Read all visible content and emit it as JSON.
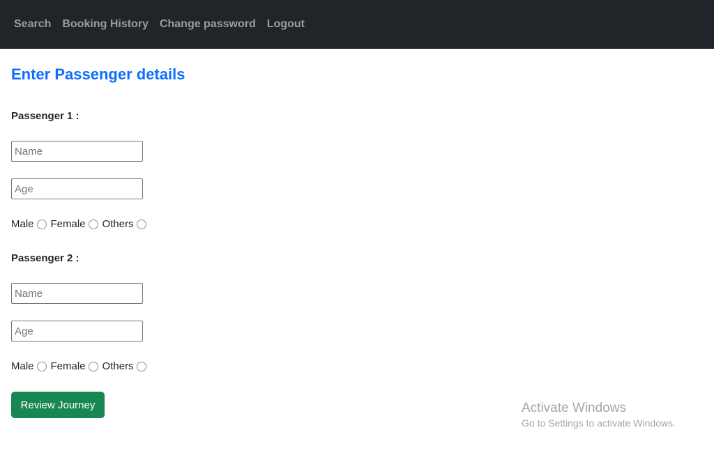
{
  "nav": {
    "items": [
      {
        "label": "Search"
      },
      {
        "label": "Booking History"
      },
      {
        "label": "Change password"
      },
      {
        "label": "Logout"
      }
    ]
  },
  "page": {
    "title": "Enter Passenger details"
  },
  "passengers": [
    {
      "heading": "Passenger 1 :",
      "name_placeholder": "Name",
      "name_value": "",
      "age_placeholder": "Age",
      "age_value": "",
      "gender_options": [
        "Male",
        "Female",
        "Others"
      ]
    },
    {
      "heading": "Passenger 2 :",
      "name_placeholder": "Name",
      "name_value": "",
      "age_placeholder": "Age",
      "age_value": "",
      "gender_options": [
        "Male",
        "Female",
        "Others"
      ]
    }
  ],
  "actions": {
    "review_label": "Review Journey"
  },
  "watermark": {
    "title": "Activate Windows",
    "subtitle": "Go to Settings to activate Windows."
  },
  "colors": {
    "navbar_bg": "#212529",
    "title": "#0d6efd",
    "review_button": "#198754"
  }
}
